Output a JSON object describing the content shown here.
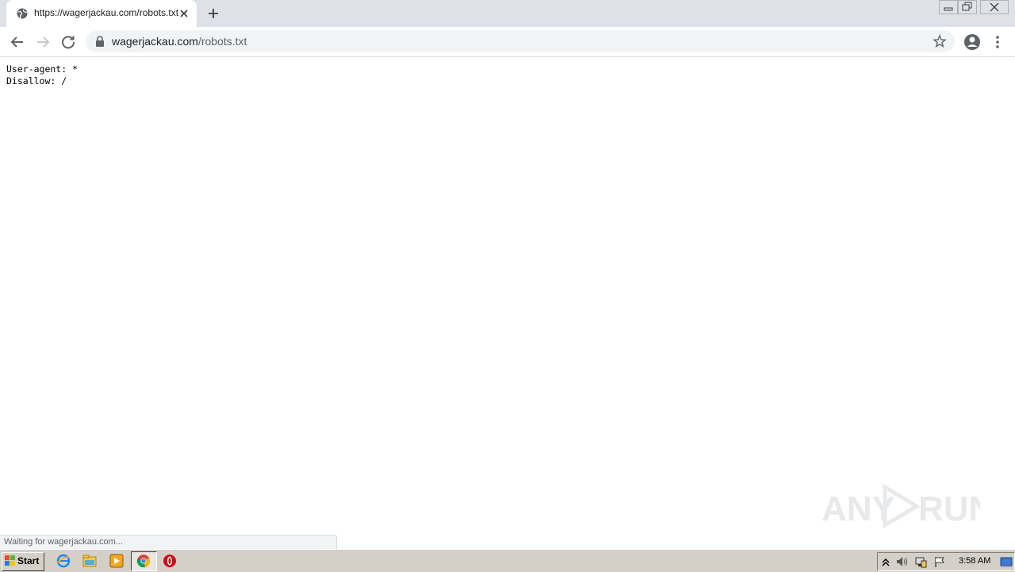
{
  "browser": {
    "tab": {
      "title": "https://wagerjackau.com/robots.txt"
    },
    "omnibox": {
      "domain": "wagerjackau.com",
      "path": "/robots.txt"
    },
    "status": "Waiting for wagerjackau.com..."
  },
  "page": {
    "lines": [
      "User-agent: *",
      "Disallow: /"
    ]
  },
  "watermark": {
    "text": "ANY RUN"
  },
  "taskbar": {
    "start_label": "Start",
    "clock": "3:58 AM"
  },
  "icons": {
    "tab_favicon": "globe-icon",
    "lock": "lock-icon",
    "star": "star-icon",
    "profile": "account-circle-icon",
    "menu": "more-vert-icon"
  },
  "colors": {
    "tabbar": "#dee1e6",
    "omnibox": "#f1f3f4",
    "taskbar": "#d4d0c8"
  }
}
